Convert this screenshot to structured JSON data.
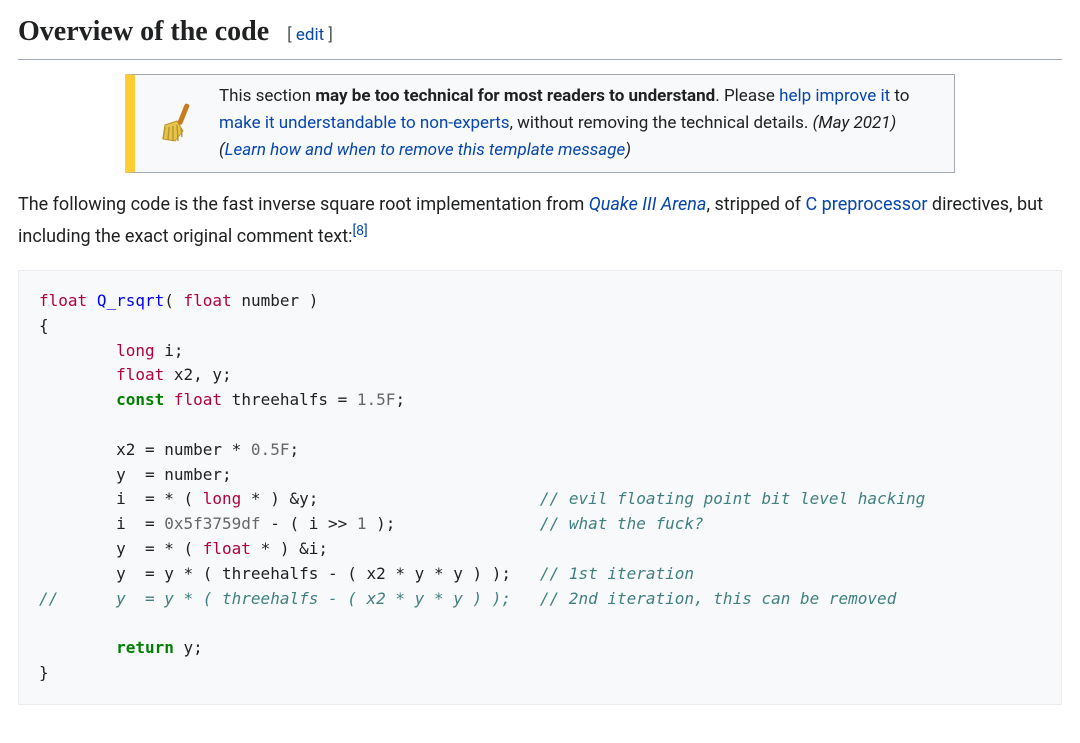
{
  "heading": {
    "title": "Overview of the code",
    "edit_left": "[ ",
    "edit_link": "edit",
    "edit_right": " ]"
  },
  "ambox": {
    "lead_text": "This section ",
    "bold_issue": "may be too technical for most readers to understand",
    "period_please": ". Please ",
    "help_link": "help improve it",
    "to_text": " to ",
    "understandable_link": "make it understandable to non-experts",
    "after_understandable": ", without removing the technical details. ",
    "date": "(May 2021)",
    "space_open_paren": " (",
    "learn_link": "Learn how and when to remove this template message",
    "close_paren": ")"
  },
  "intro": {
    "p1": "The following code is the fast inverse square root implementation from ",
    "quake_link": "Quake III Arena",
    "p2": ", stripped of ",
    "cprep_link": "C preprocessor",
    "p3": " directives, but including the exact original comment text:",
    "ref": "[8]"
  },
  "code": {
    "kw_const": "const",
    "kw_return": "return",
    "ty_float": "float",
    "ty_long": "long",
    "fn_name": "Q_rsqrt",
    "sig_open": "( ",
    "sig_param": "number",
    "sig_close": " )",
    "lbrace": "{",
    "rbrace": "}",
    "decl_i": " i;",
    "decl_x2y": " x2, y;",
    "decl_three": " threehalfs = ",
    "lit_15F": "1.5F",
    "semi": ";",
    "line_x2": "\tx2 = number * ",
    "lit_05F": "0.5F",
    "line_y": "\ty  = number;",
    "line_i_cast": "\ti  = * ( ",
    "cast_tail_amp_y": " * ) &y;",
    "com_evil": "                       // evil floating point bit level hacking",
    "line_magic_pre": "\ti  = ",
    "magic_hex": "0x5f3759df",
    "line_magic_suf": " - ( i >> ",
    "lit_1": "1",
    "line_magic_end": " );",
    "com_wtf": "               // what the fuck?",
    "line_y_cast_pre": "\ty  = * ( ",
    "cast_tail_amp_i": " * ) &i;",
    "line_iter1": "\ty  = y * ( threehalfs - ( x2 * y * y ) );",
    "com_iter1": "   // 1st iteration",
    "line_iter2_comment": "//\ty  = y * ( threehalfs - ( x2 * y * y ) );   // 2nd iteration, this can be removed",
    "return_tail": " y;"
  }
}
